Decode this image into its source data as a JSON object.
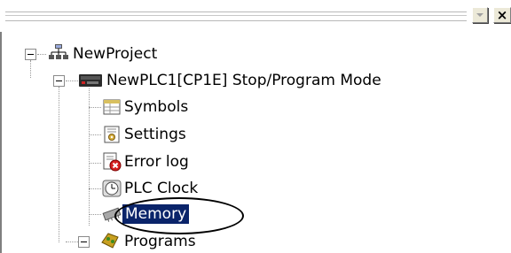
{
  "tree": {
    "items": [
      {
        "label": "NewProject",
        "icon": "network-project-icon"
      },
      {
        "label": "NewPLC1[CP1E] Stop/Program Mode",
        "icon": "plc-device-icon"
      },
      {
        "label": "Symbols",
        "icon": "symbols-table-icon"
      },
      {
        "label": "Settings",
        "icon": "settings-icon"
      },
      {
        "label": "Error log",
        "icon": "error-log-icon"
      },
      {
        "label": "PLC Clock",
        "icon": "plc-clock-icon"
      },
      {
        "label": "Memory",
        "icon": "memory-chip-icon",
        "selected": true
      },
      {
        "label": "Programs",
        "icon": "programs-icon"
      }
    ]
  },
  "colors": {
    "selection_bg": "#0a246a",
    "selection_text": "#ffffff",
    "highlight_ring": "#000000"
  }
}
